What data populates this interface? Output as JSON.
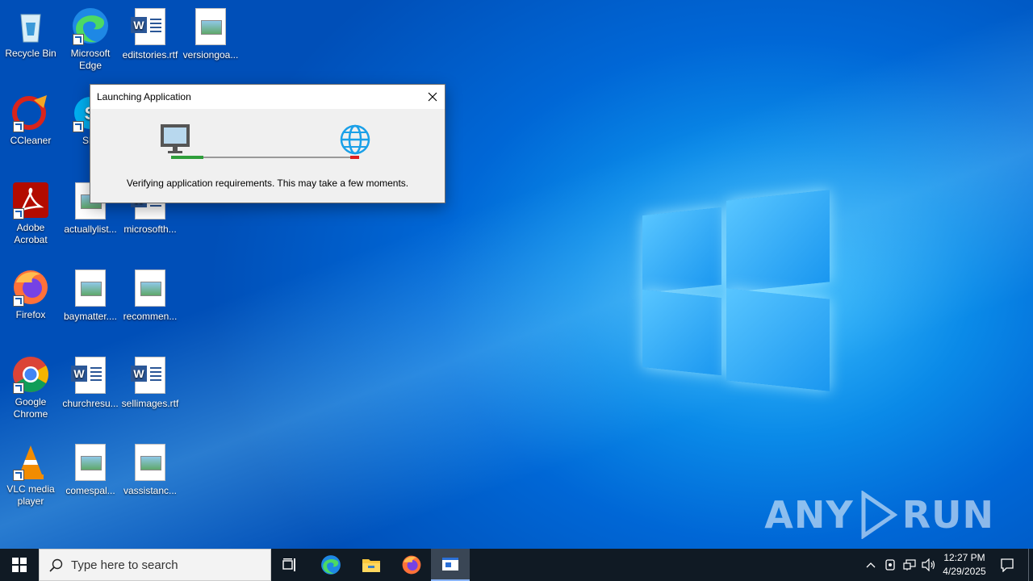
{
  "desktop": {
    "icons": [
      {
        "label": "Recycle Bin",
        "icon": "recycle-bin-icon"
      },
      {
        "label": "Microsoft Edge",
        "icon": "edge-icon"
      },
      {
        "label": "editstories.rtf",
        "icon": "word-document-icon"
      },
      {
        "label": "versiongoa...",
        "icon": "image-file-icon"
      },
      {
        "label": "CCleaner",
        "icon": "ccleaner-icon"
      },
      {
        "label": "Sky",
        "icon": "skype-icon"
      },
      {
        "label": "Adobe Acrobat",
        "icon": "acrobat-icon"
      },
      {
        "label": "actuallylist...",
        "icon": "image-file-icon"
      },
      {
        "label": "microsofth...",
        "icon": "word-document-icon"
      },
      {
        "label": "Firefox",
        "icon": "firefox-icon"
      },
      {
        "label": "baymatter....",
        "icon": "image-file-icon"
      },
      {
        "label": "recommen...",
        "icon": "image-file-icon"
      },
      {
        "label": "Google Chrome",
        "icon": "chrome-icon"
      },
      {
        "label": "churchresu...",
        "icon": "word-document-icon"
      },
      {
        "label": "sellimages.rtf",
        "icon": "word-document-icon"
      },
      {
        "label": "VLC media player",
        "icon": "vlc-icon"
      },
      {
        "label": "comespal...",
        "icon": "image-file-icon"
      },
      {
        "label": "vassistanc...",
        "icon": "image-file-icon"
      }
    ]
  },
  "dialog": {
    "title": "Launching Application",
    "message": "Verifying application requirements. This may take a few moments.",
    "progress": 0.17
  },
  "taskbar": {
    "search_placeholder": "Type here to search",
    "time": "12:27 PM",
    "date": "4/29/2025"
  },
  "watermark": {
    "text_left": "ANY",
    "text_right": "RUN"
  }
}
